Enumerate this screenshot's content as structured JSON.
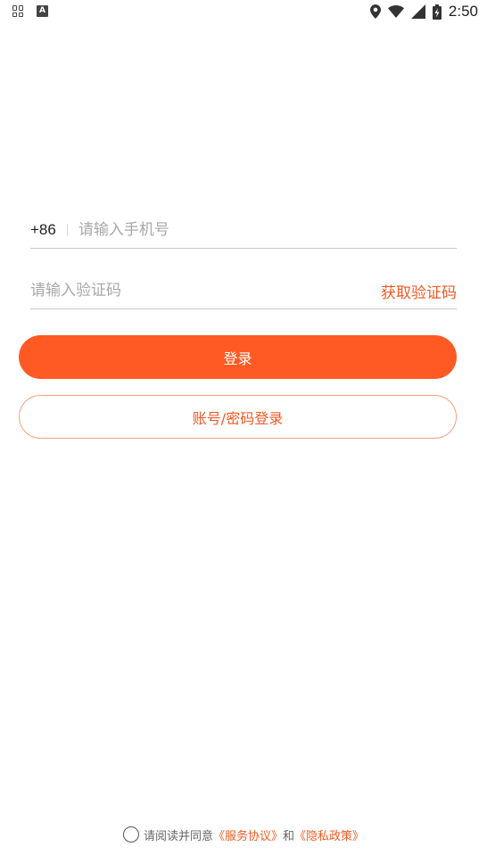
{
  "status_bar": {
    "time": "2:50",
    "icons": [
      "screenshot-icon",
      "a-icon",
      "location-icon",
      "wifi-icon",
      "signal-icon",
      "battery-charging-icon"
    ]
  },
  "phone_field": {
    "country_code": "+86",
    "value": "",
    "placeholder": "请输入手机号"
  },
  "code_field": {
    "value": "",
    "placeholder": "请输入验证码",
    "get_code_label": "获取验证码"
  },
  "login_button": {
    "label": "登录"
  },
  "password_login_button": {
    "label": "账号/密码登录"
  },
  "agreement": {
    "prefix": "请阅读并同意",
    "service_link": "《服务协议》",
    "conjunction": "和",
    "privacy_link": "《隐私政策》"
  },
  "colors": {
    "accent": "#ff5a23",
    "link": "#f25a23",
    "placeholder": "#a8a8a8"
  }
}
